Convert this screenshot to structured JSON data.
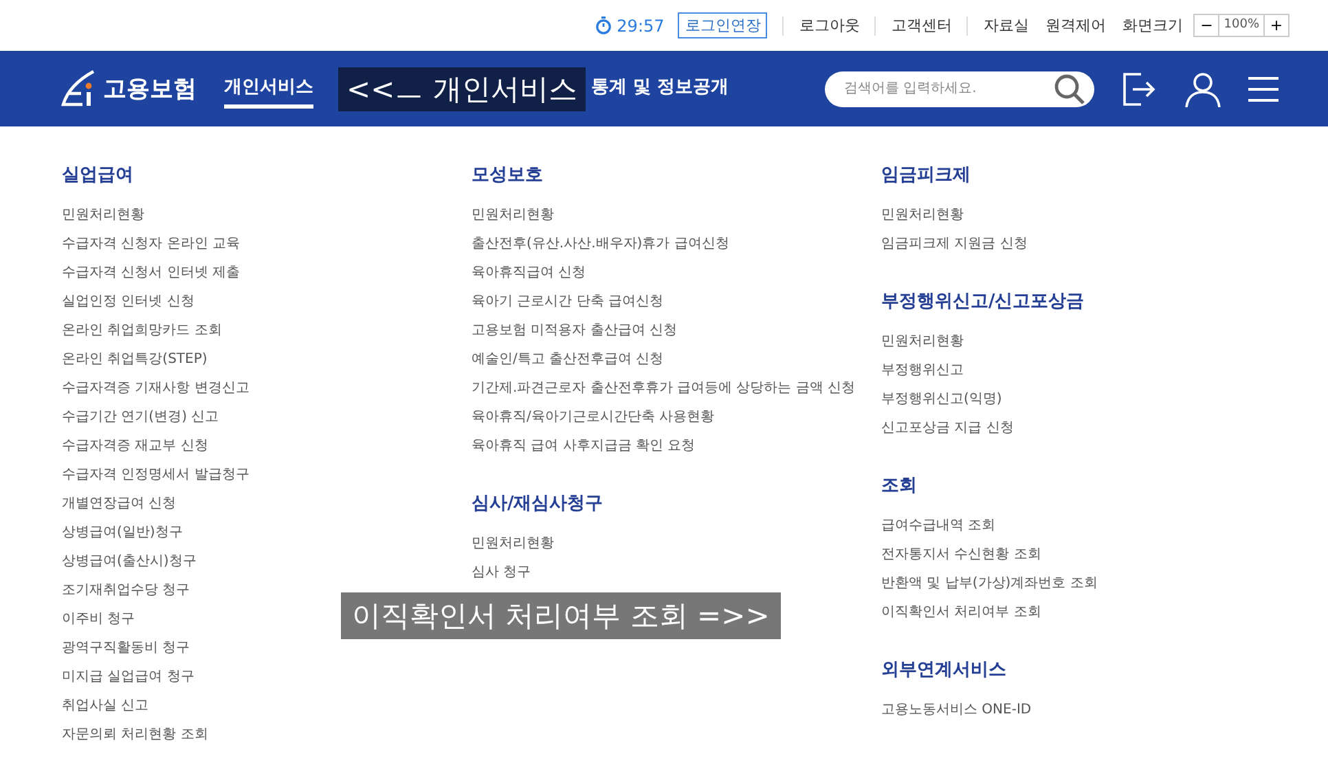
{
  "top_bar": {
    "timer": "29:57",
    "extend_button": "로그인연장",
    "links": [
      "로그아웃",
      "고객센터",
      "자료실",
      "원격제어"
    ],
    "zoom_label": "화면크기",
    "zoom_out": "−",
    "zoom_value": "100%",
    "zoom_in": "+"
  },
  "header": {
    "logo": "고용보험",
    "nav": [
      {
        "label": "개인서비스",
        "selected": true
      },
      {
        "label": "통계 및 정보공개",
        "selected": false
      }
    ],
    "search": {
      "placeholder": "검색어를 입력하세요."
    }
  },
  "overlays": [
    "<<ㅡ 개인서비스",
    "이직확인서 처리여부 조회 =>>"
  ],
  "columns": [
    [
      {
        "title": "실업급여",
        "items": [
          "민원처리현황",
          "수급자격 신청자 온라인 교육",
          "수급자격 신청서 인터넷 제출",
          "실업인정 인터넷 신청",
          "온라인 취업희망카드 조회",
          "온라인 취업특강(STEP)",
          "수급자격증 기재사항 변경신고",
          "수급기간 연기(변경) 신고",
          "수급자격증 재교부 신청",
          "수급자격 인정명세서 발급청구",
          "개별연장급여 신청",
          "상병급여(일반)청구",
          "상병급여(출산시)청구",
          "조기재취업수당 청구",
          "이주비 청구",
          "광역구직활동비 청구",
          "미지급 실업급여 청구",
          "취업사실 신고",
          "자문의뢰 처리현황 조회"
        ]
      }
    ],
    [
      {
        "title": "모성보호",
        "items": [
          "민원처리현황",
          "출산전후(유산.사산.배우자)휴가 급여신청",
          "육아휴직급여 신청",
          "육아기 근로시간 단축 급여신청",
          "고용보험 미적용자 출산급여 신청",
          "예술인/특고 출산전후급여 신청",
          "기간제.파견근로자 출산전후휴가 급여등에 상당하는 금액 신청",
          "육아휴직/육아기근로시간단축 사용현황",
          "육아휴직 급여 사후지급금 확인 요청"
        ]
      },
      {
        "title": "심사/재심사청구",
        "items": [
          "민원처리현황",
          "심사 청구"
        ]
      }
    ],
    [
      {
        "title": "임금피크제",
        "items": [
          "민원처리현황",
          "임금피크제 지원금 신청"
        ]
      },
      {
        "title": "부정행위신고/신고포상금",
        "items": [
          "민원처리현황",
          "부정행위신고",
          "부정행위신고(익명)",
          "신고포상금 지급 신청"
        ]
      },
      {
        "title": "조회",
        "items": [
          "급여수급내역 조회",
          "전자통지서 수신현황 조회",
          "반환액 및 납부(가상)계좌번호 조회",
          "이직확인서 처리여부 조회"
        ]
      },
      {
        "title": "외부연계서비스",
        "items": [
          "고용노동서비스 ONE-ID"
        ]
      }
    ]
  ]
}
